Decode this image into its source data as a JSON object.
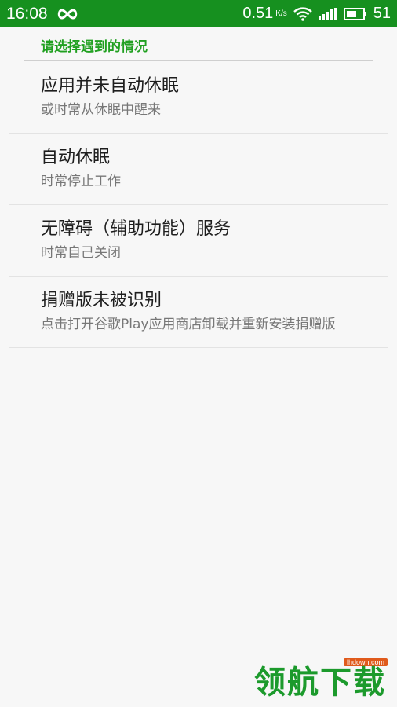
{
  "status_bar": {
    "time": "16:08",
    "infinity_icon": "infinity-icon",
    "speed_value": "0.51",
    "speed_unit": "K/s",
    "battery_level": "51",
    "colors": {
      "background": "#16901f",
      "text": "#ffffff"
    }
  },
  "header": {
    "section_title": "请选择遇到的情况",
    "accent_color": "#21a021"
  },
  "items": [
    {
      "title": "应用并未自动休眠",
      "summary": "或时常从休眠中醒来"
    },
    {
      "title": "自动休眠",
      "summary": "时常停止工作"
    },
    {
      "title": "无障碍（辅助功能）服务",
      "summary": "时常自己关闭"
    },
    {
      "title": "捐赠版未被识别",
      "summary": "点击打开谷歌Play应用商店卸载并重新安装捐赠版"
    }
  ],
  "watermark": {
    "text": "领航下载",
    "url": "lhdown.com"
  }
}
